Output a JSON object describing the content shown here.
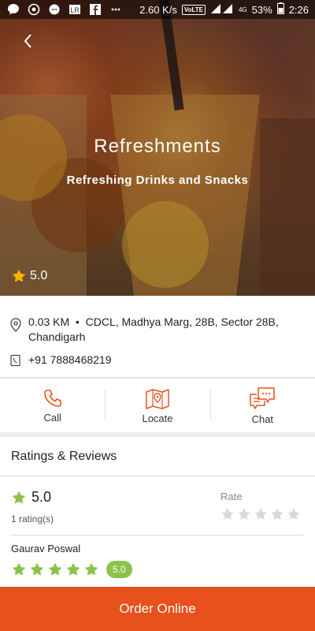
{
  "status_bar": {
    "speed": "2.60 K/s",
    "volte": "VoLTE",
    "network": "4G",
    "battery": "53%",
    "time": "2:26",
    "icons": [
      "messenger-icon",
      "whatsapp-icon",
      "chat-icon",
      "lr-icon",
      "facebook-icon",
      "more-icon",
      "signal-icon",
      "battery-icon"
    ]
  },
  "hero": {
    "title": "Refreshments",
    "subtitle": "Refreshing Drinks and Snacks",
    "rating": "5.0"
  },
  "info": {
    "distance": "0.03 KM",
    "address_line1": "CDCL, Madhya Marg, 28B, Sector 28B,",
    "address_line2": "Chandigarh",
    "phone": "+91 7888468219"
  },
  "actions": {
    "call": "Call",
    "locate": "Locate",
    "chat": "Chat"
  },
  "ratings": {
    "heading": "Ratings & Reviews",
    "score": "5.0",
    "count": "1 rating(s)",
    "rate_label": "Rate",
    "review": {
      "name": "Gaurav Poswal",
      "stars": 5,
      "badge": "5.0"
    }
  },
  "cta": {
    "label": "Order Online"
  },
  "colors": {
    "accent": "#e8501c",
    "star_green": "#8bc34a",
    "star_gold": "#f5b400",
    "star_empty": "#d8d8d8"
  }
}
